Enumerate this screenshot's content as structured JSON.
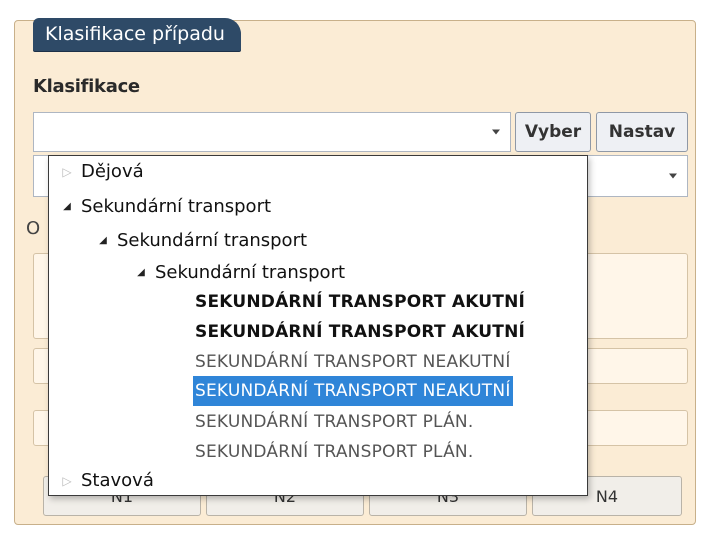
{
  "group": {
    "title": "Klasifikace případu"
  },
  "classification": {
    "label": "Klasifikace",
    "value": "",
    "select_button": "Vyber",
    "set_button": "Nastav"
  },
  "tree": {
    "roots": [
      {
        "label": "Dějová",
        "expanded": false
      },
      {
        "label": "Sekundární transport",
        "expanded": true
      },
      {
        "label": "Stavová",
        "expanded": false
      }
    ],
    "level2_label": "Sekundární transport",
    "level3_label": "Sekundární transport",
    "leaves": [
      {
        "label": "SEKUNDÁRNÍ TRANSPORT AKUTNÍ",
        "state": "normal"
      },
      {
        "label": "SEKUNDÁRNÍ TRANSPORT AKUTNÍ",
        "state": "normal"
      },
      {
        "label": "SEKUNDÁRNÍ TRANSPORT NEAKUTNÍ",
        "state": "normal"
      },
      {
        "label": "SEKUNDÁRNÍ TRANSPORT NEAKUTNÍ",
        "state": "selected"
      },
      {
        "label": "SEKUNDÁRNÍ TRANSPORT PLÁN.",
        "state": "normal"
      },
      {
        "label": "SEKUNDÁRNÍ TRANSPORT PLÁN.",
        "state": "normal"
      }
    ]
  },
  "partial_visible": {
    "section_letter": "O",
    "bottom_buttons": [
      "N1",
      "N2",
      "N3",
      "N4"
    ]
  },
  "colors": {
    "panel_bg": "#fbecd5",
    "tab_bg": "#2e4a67",
    "selection": "#2f85d8"
  }
}
